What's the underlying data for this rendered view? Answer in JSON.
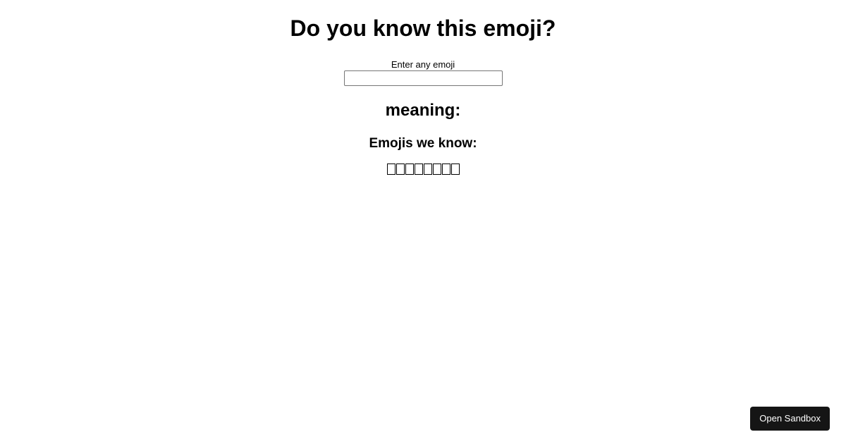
{
  "header": {
    "title": "Do you know this emoji?"
  },
  "form": {
    "label": "Enter any emoji",
    "value": "",
    "placeholder": ""
  },
  "result": {
    "meaning_label": "meaning:"
  },
  "known": {
    "heading": "Emojis we know:",
    "emojis": [
      "😀",
      "😂",
      "😍",
      "😎",
      "😢",
      "😡",
      "👍",
      "🙏"
    ]
  },
  "footer": {
    "open_sandbox_label": "Open Sandbox"
  }
}
